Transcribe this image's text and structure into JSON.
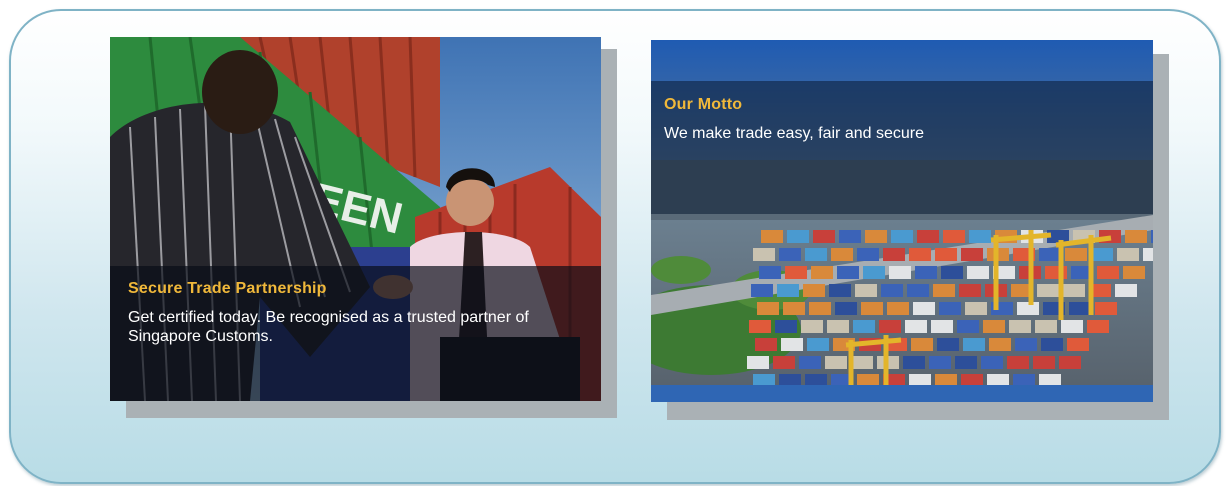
{
  "cards": [
    {
      "title": "Secure Trade Partnership",
      "text": "Get certified today. Be recognised as a trusted partner of Singapore Customs."
    },
    {
      "title": "Our Motto",
      "text": "We make trade easy, fair and secure"
    }
  ],
  "colors": {
    "caption_title": "#f0b83a",
    "frame_border": "#7fb3c6"
  },
  "images": {
    "card1": "handshake-in-front-of-shipping-containers",
    "card2": "aerial-view-of-container-port"
  }
}
